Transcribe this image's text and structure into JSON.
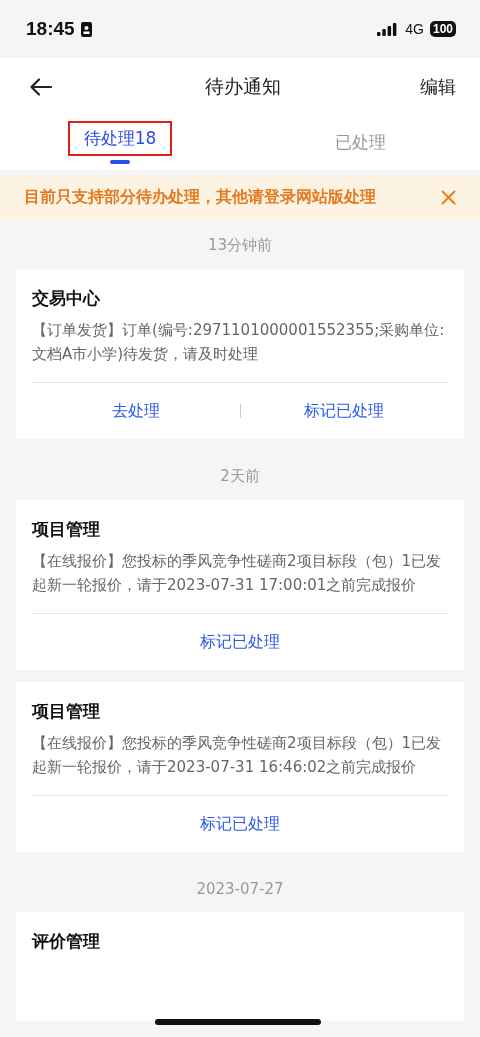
{
  "status_bar": {
    "time": "18:45",
    "network": "4G",
    "battery": "100"
  },
  "nav": {
    "title": "待办通知",
    "action": "编辑"
  },
  "tabs": [
    {
      "label": "待处理18",
      "selected": true,
      "highlighted": true
    },
    {
      "label": "已处理",
      "selected": false,
      "highlighted": false
    }
  ],
  "notice": {
    "text": "目前只支持部分待办处理，其他请登录网站版处理"
  },
  "groups": [
    {
      "time": "13分钟前",
      "cards": [
        {
          "title": "交易中心",
          "body": "【订单发货】订单(编号:2971101000001552355;采购单位:文档A市小学)待发货，请及时处理",
          "actions": [
            "去处理",
            "标记已处理"
          ]
        }
      ]
    },
    {
      "time": "2天前",
      "cards": [
        {
          "title": "项目管理",
          "body": "【在线报价】您投标的季风竞争性磋商2项目标段（包）1已发起新一轮报价，请于2023-07-31 17:00:01之前完成报价",
          "actions": [
            "标记已处理"
          ]
        },
        {
          "title": "项目管理",
          "body": "【在线报价】您投标的季风竞争性磋商2项目标段（包）1已发起新一轮报价，请于2023-07-31 16:46:02之前完成报价",
          "actions": [
            "标记已处理"
          ]
        }
      ]
    },
    {
      "time": "2023-07-27",
      "cards": [
        {
          "title": "评价管理"
        }
      ]
    }
  ]
}
